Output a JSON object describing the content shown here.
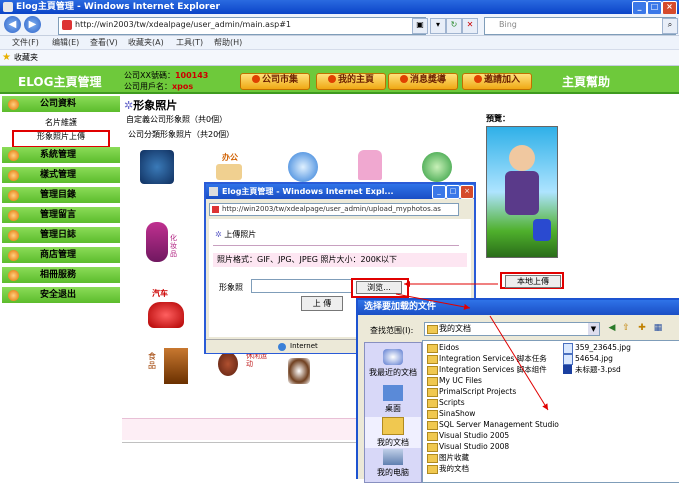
{
  "browser": {
    "window_title": "Elog主頁管理 - Windows Internet Explorer",
    "address": "http://win2003/tw/xdealpage/user_admin/main.asp#1",
    "search_placeholder": "Bing",
    "menu": [
      "文件(F)",
      "编辑(E)",
      "查看(V)",
      "收藏夹(A)",
      "工具(T)",
      "帮助(H)"
    ],
    "favorites_label": "收藏夹"
  },
  "header": {
    "title": "ELOG主頁管理",
    "account_label": "公司XX號碼：",
    "account_value": "100143",
    "user_label": "公司用戶名：",
    "user_value": "xpos",
    "buttons": [
      "公司市集",
      "我的主頁",
      "消息獎導",
      "邀請加入"
    ],
    "help": "主頁幫助"
  },
  "sidebar": {
    "groups": [
      {
        "label": "公司資料",
        "subs": [
          "名片維護",
          "形象照片上傳"
        ]
      },
      {
        "label": "系統管理"
      },
      {
        "label": "樣式管理"
      },
      {
        "label": "管理目錄"
      },
      {
        "label": "管理留言"
      },
      {
        "label": "管理日誌"
      },
      {
        "label": "商店管理"
      },
      {
        "label": "相冊服務"
      },
      {
        "label": "安全退出"
      }
    ]
  },
  "main": {
    "title": "形象照片",
    "custom_count_line": "自定義公司形象照（共0個）",
    "category_count_line": "公司分類形象照片（共20個）",
    "thumb_labels": {
      "office": "办公",
      "beauty": "化妆品",
      "car": "汽车",
      "food": "食品",
      "leisure": "休闲运动"
    },
    "preview_label": "預覽：",
    "local_upload": "本地上傳"
  },
  "popup": {
    "title": "Elog主頁管理 - Windows Internet Expl...",
    "address": "http://win2003/tw/xdealpage/user_admin/upload_myphotos.as",
    "heading": "上傳照片",
    "format_note": "照片格式：GIF、JPG、JPEG 照片大小：200K以下",
    "field_label": "形象照",
    "browse": "浏览...",
    "upload": "上 傳",
    "status": "Internet"
  },
  "file_dialog": {
    "title": "选择要加载的文件",
    "look_in_label": "查找范围(I):",
    "look_in_value": "我的文档",
    "places": [
      "我最近的文档",
      "桌面",
      "我的文档",
      "我的电脑"
    ],
    "folders": [
      "Eidos",
      "Integration Services 脚本任务",
      "Integration Services 脚本组件",
      "My UC Files",
      "PrimalScript Projects",
      "Scripts",
      "SinaShow",
      "SQL Server Management Studio",
      "Visual Studio 2005",
      "Visual Studio 2008",
      "图片收藏",
      "我的文档"
    ],
    "files": [
      "359_23645.jpg",
      "54654.jpg",
      "未标题-3.psd"
    ]
  },
  "colors": {
    "header_green": "#6ec93b",
    "highlight_red": "#e00000",
    "ie_blue": "#2a6ae0"
  }
}
